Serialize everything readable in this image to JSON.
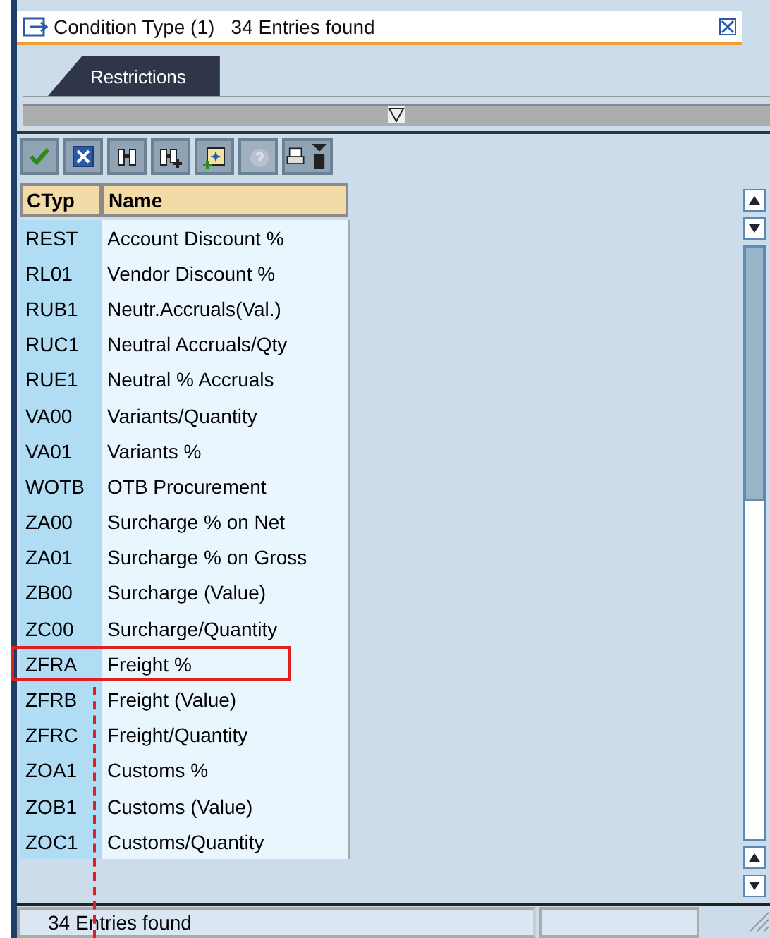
{
  "window": {
    "title": "Condition Type (1)   34 Entries found"
  },
  "tabs": [
    {
      "label": "Restrictions",
      "selected": true
    }
  ],
  "toolbar": [
    {
      "kind": "check",
      "disabled": false
    },
    {
      "kind": "cancel",
      "disabled": false
    },
    {
      "kind": "find",
      "disabled": false
    },
    {
      "kind": "find-next",
      "disabled": false
    },
    {
      "kind": "new",
      "disabled": false
    },
    {
      "kind": "help",
      "disabled": true
    },
    {
      "kind": "print",
      "disabled": false
    }
  ],
  "table": {
    "columns": [
      "CTyp",
      "Name"
    ],
    "rows": [
      {
        "ctyp": "REST",
        "name": "Account Discount %",
        "marked": false
      },
      {
        "ctyp": "RL01",
        "name": "Vendor Discount %",
        "marked": false
      },
      {
        "ctyp": "RUB1",
        "name": "Neutr.Accruals(Val.)",
        "marked": false
      },
      {
        "ctyp": "RUC1",
        "name": "Neutral Accruals/Qty",
        "marked": false
      },
      {
        "ctyp": "RUE1",
        "name": "Neutral % Accruals",
        "marked": false
      },
      {
        "ctyp": "VA00",
        "name": "Variants/Quantity",
        "marked": false
      },
      {
        "ctyp": "VA01",
        "name": "Variants %",
        "marked": false
      },
      {
        "ctyp": "WOTB",
        "name": "OTB Procurement",
        "marked": false
      },
      {
        "ctyp": "ZA00",
        "name": "Surcharge % on Net",
        "marked": false
      },
      {
        "ctyp": "ZA01",
        "name": "Surcharge % on Gross",
        "marked": false
      },
      {
        "ctyp": "ZB00",
        "name": "Surcharge (Value)",
        "marked": false
      },
      {
        "ctyp": "ZC00",
        "name": "Surcharge/Quantity",
        "marked": false
      },
      {
        "ctyp": "ZFRA",
        "name": "Freight %",
        "marked": true
      },
      {
        "ctyp": "ZFRB",
        "name": "Freight (Value)",
        "marked": false
      },
      {
        "ctyp": "ZFRC",
        "name": "Freight/Quantity",
        "marked": false
      },
      {
        "ctyp": "ZOA1",
        "name": "Customs %",
        "marked": false
      },
      {
        "ctyp": "ZOB1",
        "name": "Customs (Value)",
        "marked": false
      },
      {
        "ctyp": "ZOC1",
        "name": "Customs/Quantity",
        "marked": false
      }
    ]
  },
  "status_bar": {
    "message": "34 Entries found"
  }
}
